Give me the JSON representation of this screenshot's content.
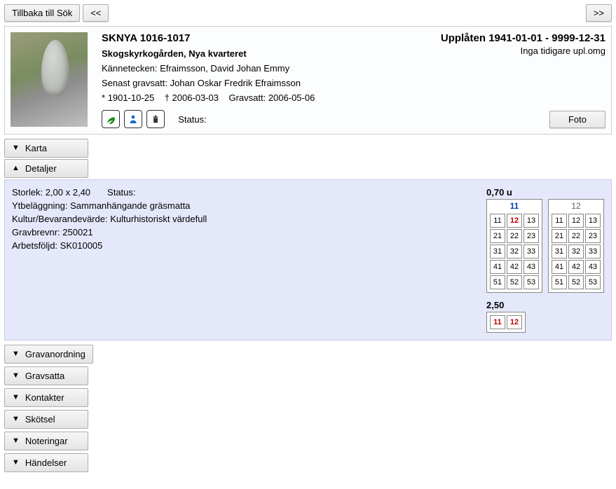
{
  "toolbar": {
    "back_label": "Tillbaka till Sök",
    "prev_label": "<<",
    "next_label": ">>"
  },
  "main": {
    "code": "SKNYA 1016-1017",
    "location": "Skogskyrkogården, Nya kvarteret",
    "kannetecken_label": "Kännetecken:",
    "kannetecken_value": "Efraimsson, David Johan Emmy",
    "senast_label": "Senast gravsatt:",
    "senast_value": "Johan Oskar Fredrik Efraimsson",
    "birth_prefix": "*",
    "birth_date": "1901-10-25",
    "death_prefix": "†",
    "death_date": "2006-03-03",
    "gravsatt_label": "Gravsatt:",
    "gravsatt_date": "2006-05-06",
    "status_label": "Status:",
    "lease_label": "Upplåten",
    "lease_dates": "1941-01-01 - 9999-12-31",
    "previous_text": "Inga tidigare upl.omg",
    "foto_btn": "Foto",
    "icons": {
      "leaf": "leaf-icon",
      "person": "person-icon",
      "bin": "bin-icon"
    }
  },
  "accordions": {
    "karta": "Karta",
    "detaljer": "Detaljer",
    "gravanordning": "Gravanordning",
    "gravsatta": "Gravsatta",
    "kontakter": "Kontakter",
    "skotsel": "Skötsel",
    "noteringar": "Noteringar",
    "handelser": "Händelser"
  },
  "details": {
    "storlek_label": "Storlek:",
    "storlek_value": "2,00 x 2,40",
    "status_label": "Status:",
    "ytbelaggning_label": "Ytbeläggning:",
    "ytbelaggning_value": "Sammanhängande gräsmatta",
    "kultur_label": "Kultur/Bevarandevärde:",
    "kultur_value": "Kulturhistoriskt värdefull",
    "gravbrev_label": "Gravbrevnr:",
    "gravbrev_value": "250021",
    "arbets_label": "Arbetsföljd:",
    "arbets_value": "SK010005"
  },
  "gridA": {
    "block_label": "0,70 u",
    "left": {
      "header": "11",
      "cells": [
        [
          "11",
          "12",
          "13"
        ],
        [
          "21",
          "22",
          "23"
        ],
        [
          "31",
          "32",
          "33"
        ],
        [
          "41",
          "42",
          "43"
        ],
        [
          "51",
          "52",
          "53"
        ]
      ],
      "highlight": [
        0,
        1
      ]
    },
    "right": {
      "header": "12",
      "cells": [
        [
          "11",
          "12",
          "13"
        ],
        [
          "21",
          "22",
          "23"
        ],
        [
          "31",
          "32",
          "33"
        ],
        [
          "41",
          "42",
          "43"
        ],
        [
          "51",
          "52",
          "53"
        ]
      ]
    }
  },
  "gridB": {
    "block_label": "2,50",
    "cells": [
      [
        "11",
        "12"
      ]
    ]
  }
}
